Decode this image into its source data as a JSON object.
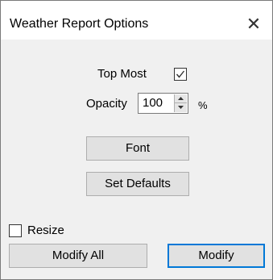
{
  "window": {
    "title": "Weather Report Options",
    "close_glyph": "✕"
  },
  "options": {
    "top_most": {
      "label": "Top Most",
      "checked": true
    },
    "opacity": {
      "label": "Opacity",
      "value": "100",
      "unit": "%"
    },
    "resize": {
      "label": "Resize",
      "checked": false
    }
  },
  "buttons": {
    "font": "Font",
    "set_defaults": "Set Defaults",
    "modify_all": "Modify All",
    "modify": "Modify"
  },
  "colors": {
    "focus_border": "#0078d7",
    "button_face": "#e1e1e1",
    "dialog_bg": "#f0f0f0"
  }
}
